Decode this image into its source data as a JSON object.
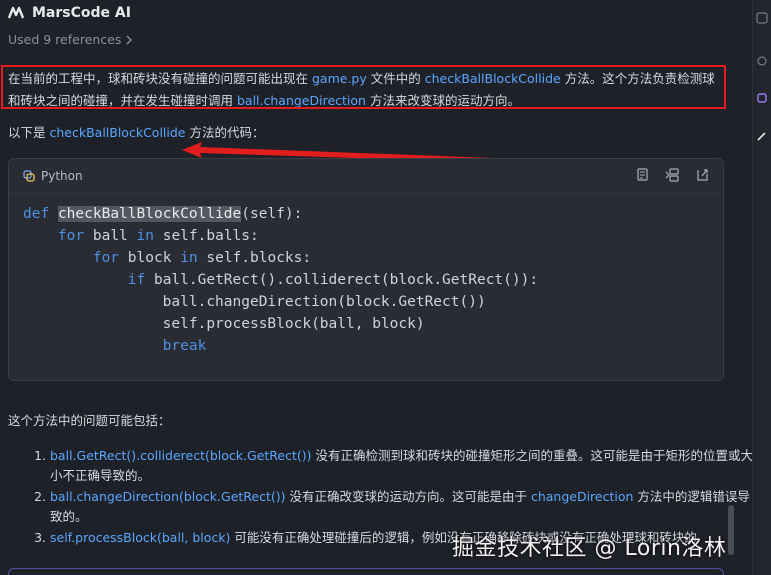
{
  "header": {
    "title": "MarsCode AI",
    "logo_icon": "marscode-logo-icon"
  },
  "references": {
    "label": "Used 9 references",
    "chevron_icon": "chevron-right-icon"
  },
  "answer": {
    "p1_before": "在当前的工程中，球和砖块没有碰撞的问题可能出现在 ",
    "p1_file": "game.py",
    "p1_mid": " 文件中的 ",
    "p1_method": "checkBallBlockCollide",
    "p1_after": " 方法。这个方法负责检测球和砖块之间的碰撞，并在发生碰撞时调用 ",
    "p1_call": "ball.changeDirection",
    "p1_end": " 方法来改变球的运动方向。",
    "p2_before": "以下是 ",
    "p2_method": "checkBallBlockCollide",
    "p2_after": " 方法的代码：",
    "p3": "这个方法中的问题可能包括："
  },
  "code": {
    "language": "Python",
    "tools": [
      "copy-icon",
      "insert-icon",
      "apply-icon"
    ],
    "lines": {
      "l1_kw": "def",
      "l1_name": "checkBallBlockCollide",
      "l1_rest": "(self):",
      "l2_ind": "    ",
      "l2_kw": "for",
      "l2_a": " ball ",
      "l2_kw2": "in",
      "l2_b": " self.balls:",
      "l3_ind": "        ",
      "l3_kw": "for",
      "l3_a": " block ",
      "l3_kw2": "in",
      "l3_b": " self.blocks:",
      "l4_ind": "            ",
      "l4_kw": "if",
      "l4_a": " ball.GetRect().colliderect(block.GetRect()):",
      "l5": "                ball.changeDirection(block.GetRect())",
      "l6": "                self.processBlock(ball, block)",
      "l7_ind": "                ",
      "l7_kw": "break"
    }
  },
  "issues": [
    {
      "code": "ball.GetRect().colliderect(block.GetRect())",
      "text": " 没有正确检测到球和砖块的碰撞矩形之间的重叠。这可能是由于矩形的位置或大小不正确导致的。"
    },
    {
      "code": "ball.changeDirection(block.GetRect())",
      "text": " 没有正确改变球的运动方向。这可能是由于 ",
      "code2": "changeDirection",
      "text2": " 方法中的逻辑错误导致的。"
    },
    {
      "code": "self.processBlock(ball, block)",
      "text": " 可能没有正确处理碰撞后的逻辑，例如没有正确移除砖块或没有正确处理球和砖块的"
    }
  ],
  "watermark": "掘金技术社区 @ Lorin洛林",
  "colors": {
    "accent": "#5aa7ff",
    "keyword": "#4f8fe6",
    "annotation": "#e21d1d",
    "background": "#1f2128"
  }
}
